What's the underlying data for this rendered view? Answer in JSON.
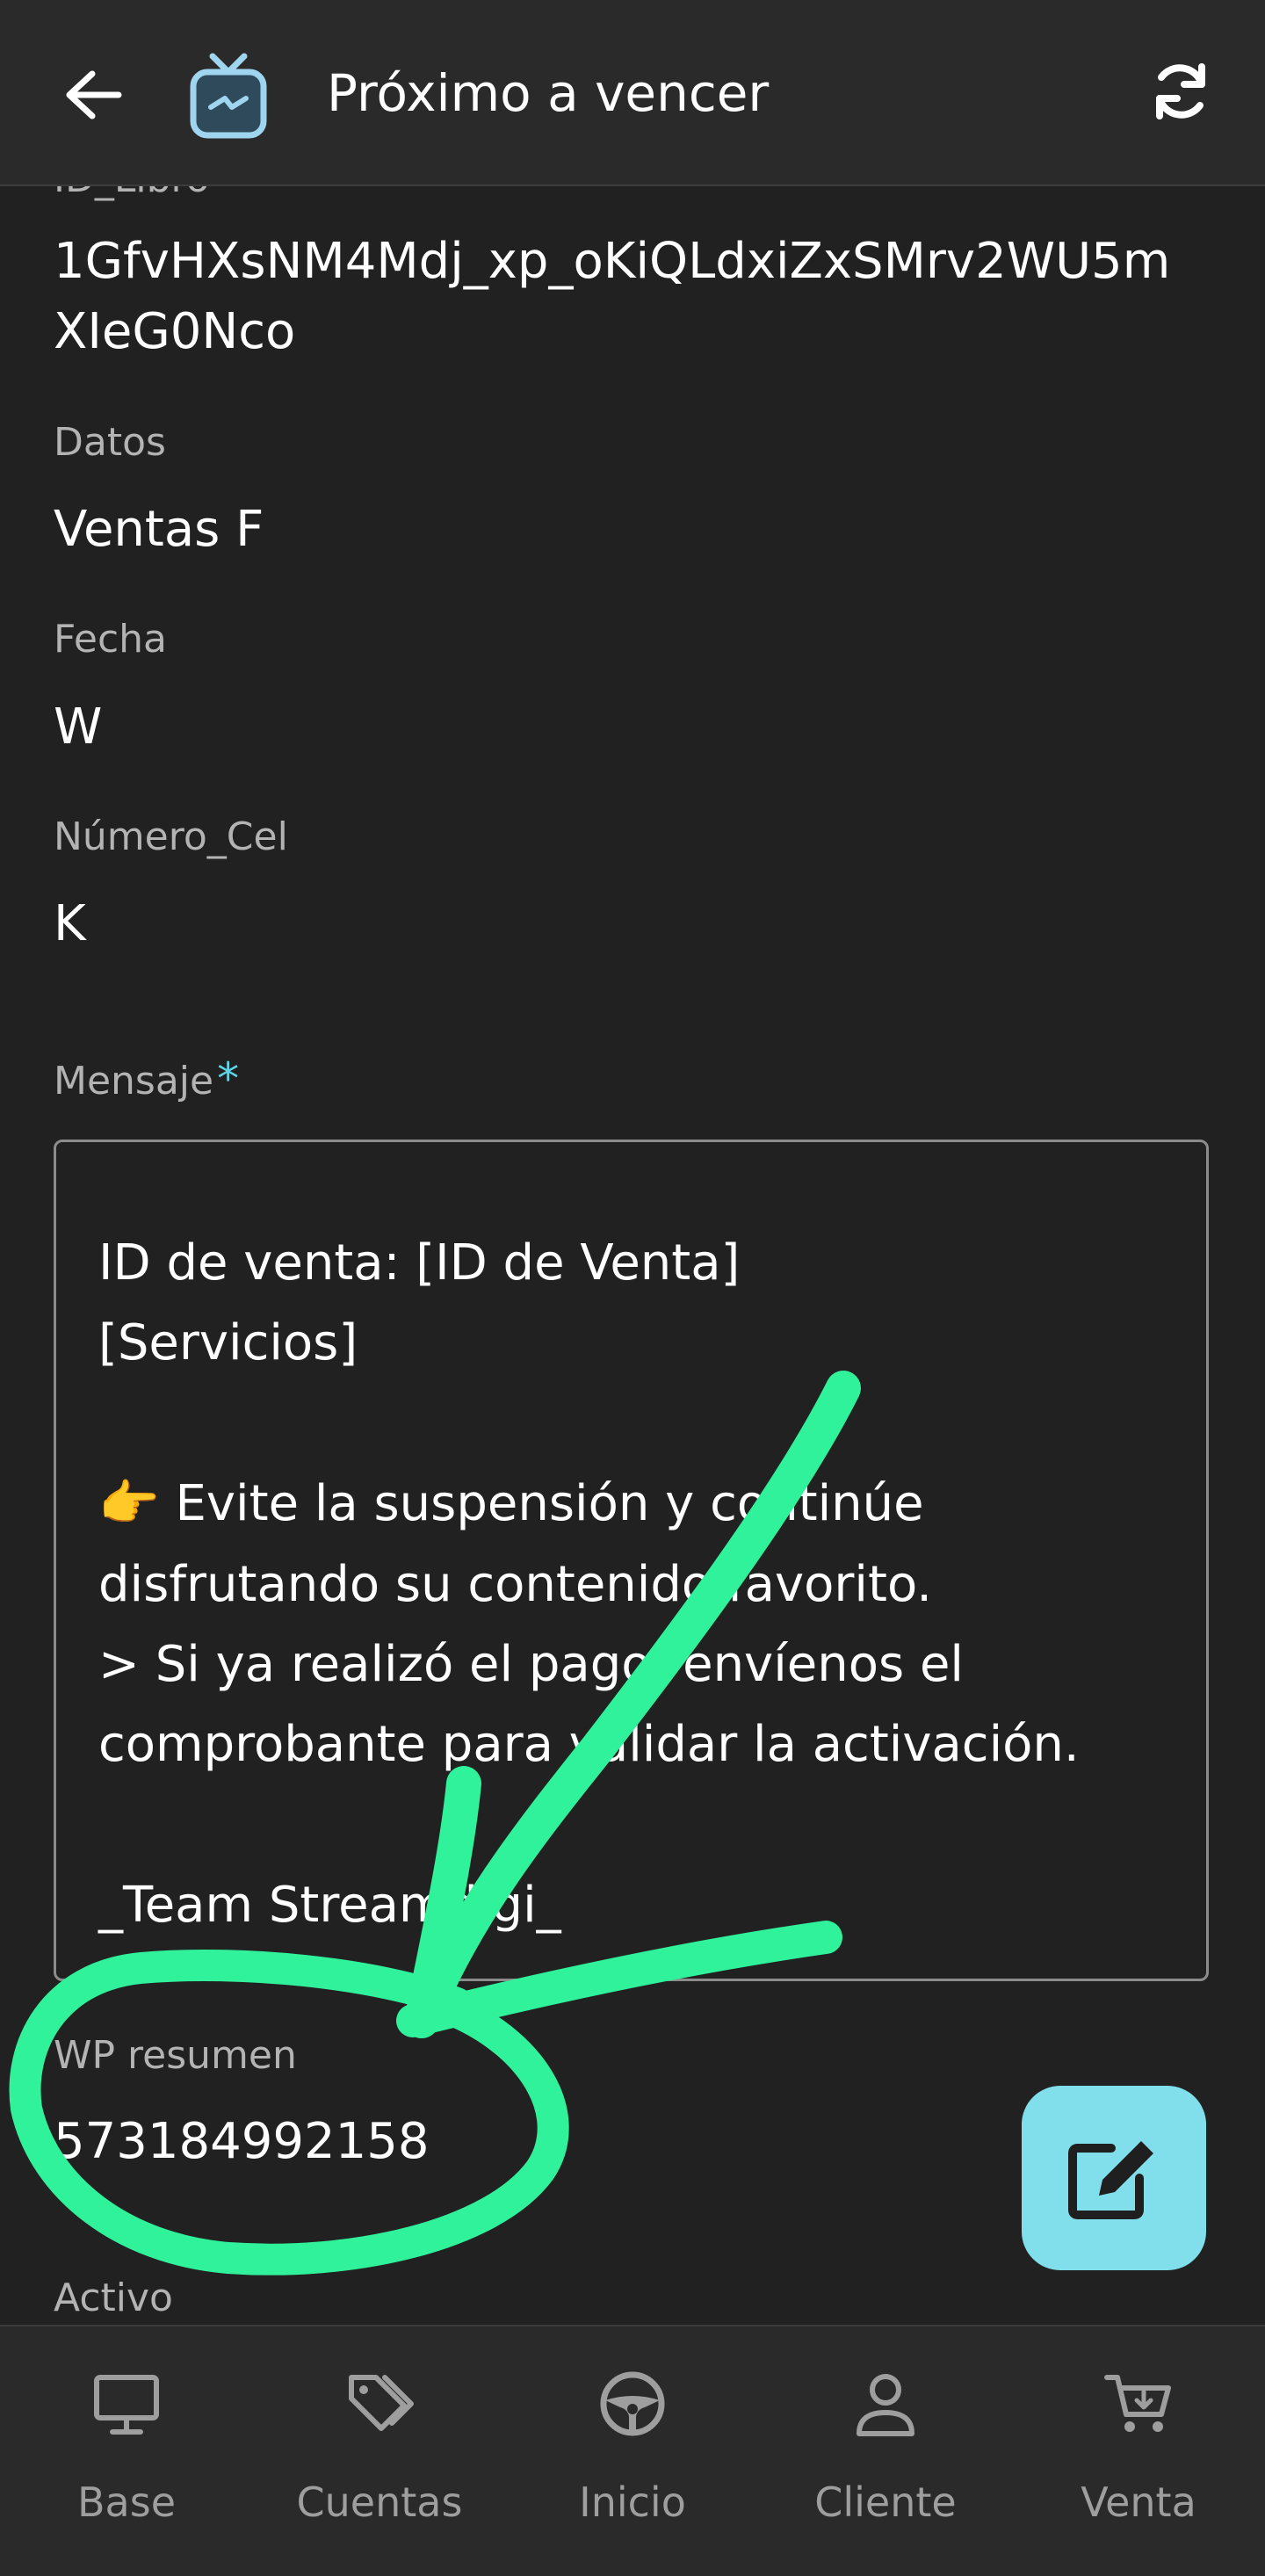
{
  "header": {
    "title": "Próximo a vencer",
    "back_icon": "arrow-left-icon",
    "logo_icon": "tv-logo-icon",
    "sync_icon": "sync-icon"
  },
  "fields": {
    "id_libro_label": "ID_Libro",
    "id_libro_value_line1": "1GfvHXsNM4Mdj_xp_oKiQLdxiZxSMrv2WU5m",
    "id_libro_value_line2": "XIeG0Nco",
    "datos_label": "Datos",
    "datos_value": "Ventas F",
    "fecha_label": "Fecha",
    "fecha_value": "W",
    "numero_cel_label": "Número_Cel",
    "numero_cel_value": "K",
    "mensaje_label": "Mensaje",
    "mensaje_required": "*",
    "wp_resumen_label": "WP resumen",
    "wp_resumen_value": "573184992158",
    "activo_label": "Activo"
  },
  "message": {
    "lines": [
      "ID de venta: [ID de Venta]",
      "[Servicios]",
      "👉 Evite la suspensión y continúe",
      "disfrutando su contenido favorito.",
      "> Si ya realizó el pago, envíenos el",
      "comprobante para validar la activación.",
      "_Team Streamdigi_"
    ]
  },
  "fab": {
    "icon": "edit-icon"
  },
  "bottom_nav": {
    "items": [
      {
        "label": "Base",
        "icon": "monitor-icon"
      },
      {
        "label": "Cuentas",
        "icon": "tags-icon"
      },
      {
        "label": "Inicio",
        "icon": "steering-wheel-icon"
      },
      {
        "label": "Cliente",
        "icon": "user-icon"
      },
      {
        "label": "Venta",
        "icon": "cart-icon"
      }
    ]
  },
  "colors": {
    "background": "#212121",
    "bar": "#2a2a2a",
    "accent": "#80dfeb",
    "annotation_green": "#2ff29b",
    "label_gray": "#b3b3b3"
  }
}
